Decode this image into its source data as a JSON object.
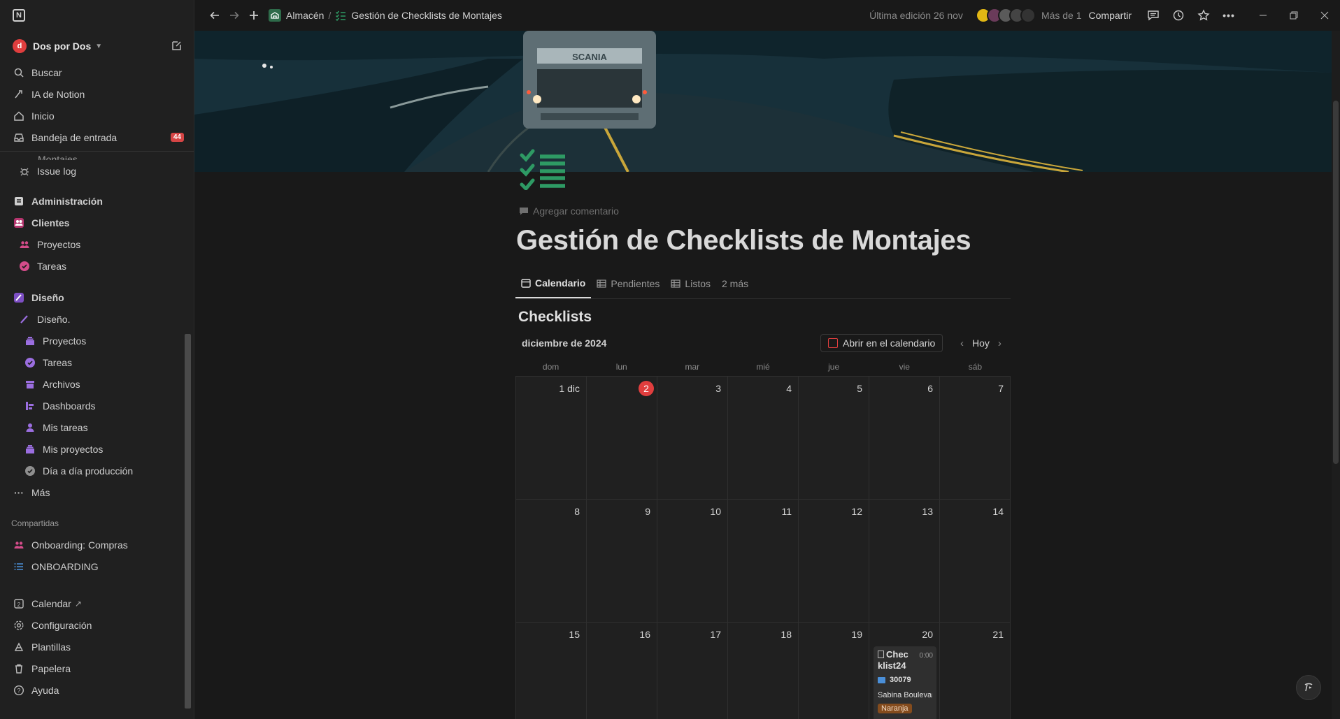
{
  "sidebar": {
    "workspace": "Dos por Dos",
    "top_items": [
      {
        "label": "Buscar",
        "icon": "search-icon"
      },
      {
        "label": "IA de Notion",
        "icon": "ai-icon"
      },
      {
        "label": "Inicio",
        "icon": "home-icon"
      },
      {
        "label": "Bandeja de entrada",
        "icon": "inbox-icon",
        "badge": "44"
      }
    ],
    "partial_item": "Montajes",
    "issue_log": "Issue log",
    "sections": [
      {
        "label": "Administración"
      },
      {
        "label": "Clientes"
      },
      {
        "label": "Proyectos"
      },
      {
        "label": "Tareas"
      },
      {
        "label": "Diseño"
      },
      {
        "label": "Diseño."
      },
      {
        "label": "Proyectos"
      },
      {
        "label": "Tareas"
      },
      {
        "label": "Archivos"
      },
      {
        "label": "Dashboards"
      },
      {
        "label": "Mis tareas"
      },
      {
        "label": "Mis proyectos"
      },
      {
        "label": "Día a día producción"
      },
      {
        "label": "Más"
      }
    ],
    "shared_label": "Compartidas",
    "shared": [
      {
        "label": "Onboarding: Compras"
      },
      {
        "label": "ONBOARDING"
      }
    ],
    "bottom": [
      {
        "label": "Calendar"
      },
      {
        "label": "Configuración"
      },
      {
        "label": "Plantillas"
      },
      {
        "label": "Papelera"
      },
      {
        "label": "Ayuda"
      }
    ]
  },
  "topbar": {
    "breadcrumb_parent": "Almacén",
    "breadcrumb_sep": "/",
    "breadcrumb_current": "Gestión de Checklists de Montajes",
    "last_edit": "Última edición 26 nov",
    "more_people": "Más de 1",
    "share": "Compartir"
  },
  "page": {
    "add_comment": "Agregar comentario",
    "title": "Gestión de Checklists de Montajes",
    "tabs": [
      {
        "label": "Calendario",
        "active": true
      },
      {
        "label": "Pendientes",
        "active": false
      },
      {
        "label": "Listos",
        "active": false
      },
      {
        "label": "2 más",
        "active": false
      }
    ],
    "db_title": "Checklists",
    "month": "diciembre de 2024",
    "open_calendar": "Abrir en el calendario",
    "today": "Hoy",
    "weekdays": [
      "dom",
      "lun",
      "mar",
      "mié",
      "jue",
      "vie",
      "sáb"
    ],
    "days": [
      "1 dic",
      "2",
      "3",
      "4",
      "5",
      "6",
      "7",
      "8",
      "9",
      "10",
      "11",
      "12",
      "13",
      "14",
      "15",
      "16",
      "17",
      "18",
      "19",
      "20",
      "21"
    ],
    "today_index": 1,
    "event": {
      "day_index": 19,
      "title_line1": "Chec",
      "title_line2": "klist24",
      "time": "0:00",
      "number": "30079",
      "person": "Sabina Boulevard",
      "tag": "Naranja"
    }
  },
  "colors": {
    "accent_red": "#e03e3e",
    "checklist_green": "#2e9a64",
    "tag_orange": "#854c1d"
  }
}
